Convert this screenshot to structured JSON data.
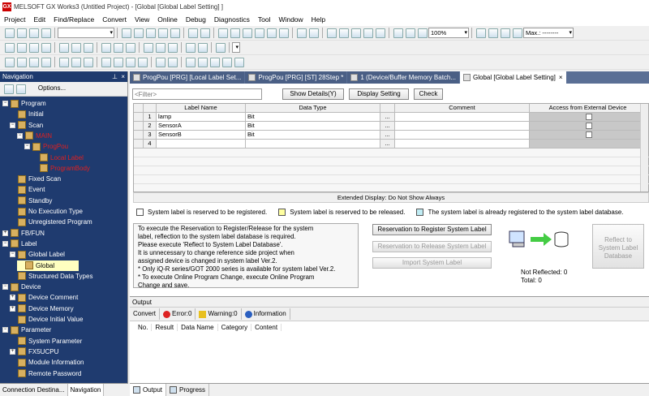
{
  "window": {
    "title": "MELSOFT GX Works3 (Untitled Project) - [Global [Global Label Setting] ]",
    "app_icon": "GX"
  },
  "menu": [
    "Project",
    "Edit",
    "Find/Replace",
    "Convert",
    "View",
    "Online",
    "Debug",
    "Diagnostics",
    "Tool",
    "Window",
    "Help"
  ],
  "toolbar": {
    "zoom": "100%",
    "max_label": "Max.: --------"
  },
  "navigation": {
    "title": "Navigation",
    "options_label": "Options...",
    "tree": [
      {
        "label": "Program",
        "indent": 0,
        "exp": "-",
        "style": "normal"
      },
      {
        "label": "Initial",
        "indent": 1,
        "exp": "",
        "style": "normal"
      },
      {
        "label": "Scan",
        "indent": 1,
        "exp": "-",
        "style": "normal"
      },
      {
        "label": "MAIN",
        "indent": 2,
        "exp": "-",
        "style": "red"
      },
      {
        "label": "ProgPou",
        "indent": 3,
        "exp": "-",
        "style": "red"
      },
      {
        "label": "Local Label",
        "indent": 4,
        "exp": "",
        "style": "red"
      },
      {
        "label": "ProgramBody",
        "indent": 4,
        "exp": "",
        "style": "red"
      },
      {
        "label": "Fixed Scan",
        "indent": 1,
        "exp": "",
        "style": "normal"
      },
      {
        "label": "Event",
        "indent": 1,
        "exp": "",
        "style": "normal"
      },
      {
        "label": "Standby",
        "indent": 1,
        "exp": "",
        "style": "normal"
      },
      {
        "label": "No Execution Type",
        "indent": 1,
        "exp": "",
        "style": "normal"
      },
      {
        "label": "Unregistered Program",
        "indent": 1,
        "exp": "",
        "style": "normal"
      },
      {
        "label": "FB/FUN",
        "indent": 0,
        "exp": "+",
        "style": "normal"
      },
      {
        "label": "Label",
        "indent": 0,
        "exp": "-",
        "style": "normal"
      },
      {
        "label": "Global Label",
        "indent": 1,
        "exp": "-",
        "style": "normal"
      },
      {
        "label": "Global",
        "indent": 2,
        "exp": "",
        "style": "selected"
      },
      {
        "label": "Structured Data Types",
        "indent": 1,
        "exp": "",
        "style": "normal"
      },
      {
        "label": "Device",
        "indent": 0,
        "exp": "-",
        "style": "normal"
      },
      {
        "label": "Device Comment",
        "indent": 1,
        "exp": "+",
        "style": "normal"
      },
      {
        "label": "Device Memory",
        "indent": 1,
        "exp": "+",
        "style": "normal"
      },
      {
        "label": "Device Initial Value",
        "indent": 1,
        "exp": "",
        "style": "normal"
      },
      {
        "label": "Parameter",
        "indent": 0,
        "exp": "-",
        "style": "normal"
      },
      {
        "label": "System Parameter",
        "indent": 1,
        "exp": "",
        "style": "normal"
      },
      {
        "label": "FX5UCPU",
        "indent": 1,
        "exp": "+",
        "style": "normal"
      },
      {
        "label": "Module Information",
        "indent": 1,
        "exp": "",
        "style": "normal"
      },
      {
        "label": "Remote Password",
        "indent": 1,
        "exp": "",
        "style": "normal"
      }
    ],
    "bottom_tabs": [
      "Connection Destina...",
      "Navigation"
    ]
  },
  "doc_tabs": [
    "ProgPou [PRG] [Local Label Set...",
    "ProgPou [PRG] [ST] 28Step *",
    "1 (Device/Buffer Memory Batch...",
    "Global [Global Label Setting]"
  ],
  "label_setting": {
    "filter_placeholder": "<Filter>",
    "show_details": "Show Details(Y)",
    "display_setting": "Display Setting",
    "check": "Check",
    "columns": [
      "Label Name",
      "Data Type",
      "Comment",
      "Access from External Device"
    ],
    "rows": [
      {
        "no": "1",
        "name": "lamp",
        "type": "Bit",
        "comment": ""
      },
      {
        "no": "2",
        "name": "SensorA",
        "type": "Bit",
        "comment": ""
      },
      {
        "no": "3",
        "name": "SensorB",
        "type": "Bit",
        "comment": ""
      },
      {
        "no": "4",
        "name": "",
        "type": "",
        "comment": ""
      }
    ],
    "ellipsis": "...",
    "extended_display": "Extended Display: Do Not Show Always",
    "legend": [
      {
        "text": "System label is reserved to be registered.",
        "color": "#ffffff"
      },
      {
        "text": "System label is reserved to be released.",
        "color": "#ffffa0"
      },
      {
        "text": "The system label is already registered to the system label database.",
        "color": "#c0ecf4"
      }
    ],
    "info_text": "To execute the Reservation to Register/Release for the system\nlabel, reflection to the system label database is required.\nPlease execute 'Reflect to System Label Database'.\nIt is unnecessary to change reference side project when\nassigned device is changed in system label Ver.2.\n* Only iQ-R series/GOT 2000 series is available for system label Ver.2.\n* To execute Online Program Change, execute Online Program\nChange and save.",
    "btn_register": "Reservation to Register System Label",
    "btn_release": "Reservation to Release System Label",
    "btn_import": "Import System Label",
    "btn_reflect": "Reflect to\nSystem Label\nDatabase",
    "not_reflected": "Not Reflected: 0",
    "total": "Total: 0"
  },
  "output": {
    "title": "Output",
    "tabs": {
      "convert": "Convert",
      "error": "Error:0",
      "warning": "Warning:0",
      "information": "Information"
    },
    "columns": [
      "No.",
      "Result",
      "Data Name",
      "Category",
      "Content"
    ],
    "bottom_tabs": [
      "Output",
      "Progress"
    ]
  },
  "colors": {
    "nav_bg": "#1f3b6f",
    "tab_bar": "#5a6f95",
    "accent_red": "#e02020"
  }
}
